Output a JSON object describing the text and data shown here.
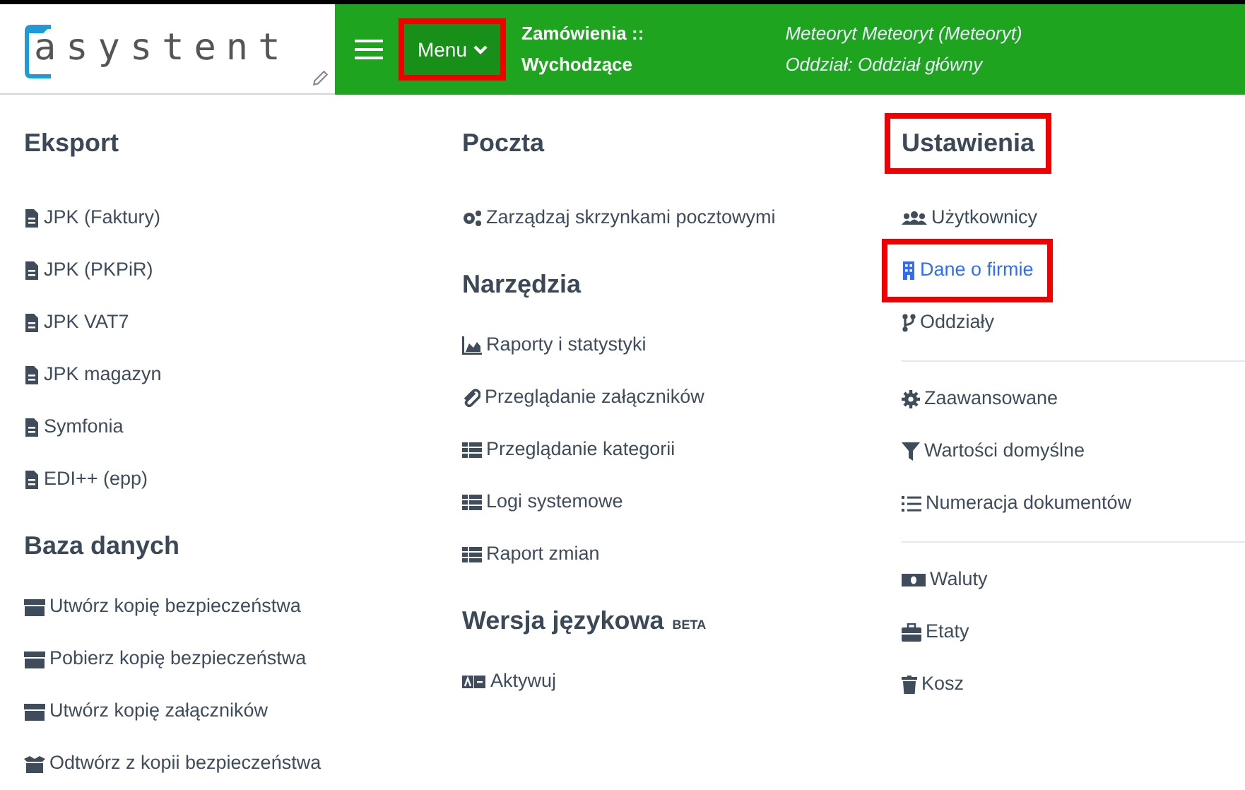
{
  "header": {
    "logo": "asystent",
    "menu_button": {
      "label": "Menu",
      "highlighted": true
    },
    "breadcrumb": [
      "Zamówienia ::",
      "Wychodzące"
    ],
    "user": "Meteoryt Meteoryt (Meteoryt)",
    "branch": "Oddział: Oddział główny"
  },
  "columns": [
    [
      {
        "kind": "heading",
        "label": "Eksport",
        "highlighted": false
      },
      {
        "kind": "item",
        "label": "JPK (Faktury)",
        "active": false,
        "highlighted": false
      },
      {
        "kind": "item",
        "label": "JPK (PKPiR)",
        "active": false,
        "highlighted": false
      },
      {
        "kind": "item",
        "label": "JPK VAT7",
        "active": false,
        "highlighted": false
      },
      {
        "kind": "item",
        "label": "JPK magazyn",
        "active": false,
        "highlighted": false
      },
      {
        "kind": "item",
        "label": "Symfonia",
        "active": false,
        "highlighted": false
      },
      {
        "kind": "item",
        "label": "EDI++ (epp)",
        "active": false,
        "highlighted": false
      },
      {
        "kind": "heading",
        "label": "Baza danych",
        "highlighted": false
      },
      {
        "kind": "item",
        "label": "Utwórz kopię bezpieczeństwa",
        "active": false,
        "highlighted": false
      },
      {
        "kind": "item",
        "label": "Pobierz kopię bezpieczeństwa",
        "active": false,
        "highlighted": false
      },
      {
        "kind": "item",
        "label": "Utwórz kopię załączników",
        "active": false,
        "highlighted": false
      },
      {
        "kind": "item",
        "label": "Odtwórz z kopii bezpieczeństwa",
        "active": false,
        "highlighted": false
      }
    ],
    [
      {
        "kind": "heading",
        "label": "Poczta",
        "highlighted": false
      },
      {
        "kind": "item",
        "label": "Zarządzaj skrzynkami pocztowymi",
        "active": false,
        "highlighted": false
      },
      {
        "kind": "heading",
        "label": "Narzędzia",
        "highlighted": false
      },
      {
        "kind": "item",
        "label": "Raporty i statystyki",
        "active": false,
        "highlighted": false
      },
      {
        "kind": "item",
        "label": "Przeglądanie załączników",
        "active": false,
        "highlighted": false
      },
      {
        "kind": "item",
        "label": "Przeglądanie kategorii",
        "active": false,
        "highlighted": false
      },
      {
        "kind": "item",
        "label": "Logi systemowe",
        "active": false,
        "highlighted": false
      },
      {
        "kind": "item",
        "label": "Raport zmian",
        "active": false,
        "highlighted": false
      },
      {
        "kind": "heading",
        "label": "Wersja językowa",
        "badge": "BETA",
        "highlighted": false
      },
      {
        "kind": "item",
        "label": "Aktywuj",
        "active": false,
        "highlighted": false
      }
    ],
    [
      {
        "kind": "heading",
        "label": "Ustawienia",
        "highlighted": true
      },
      {
        "kind": "item",
        "label": "Użytkownicy",
        "active": false,
        "highlighted": false
      },
      {
        "kind": "item",
        "label": "Dane o firmie",
        "active": true,
        "highlighted": true
      },
      {
        "kind": "item",
        "label": "Oddziały",
        "active": false,
        "highlighted": false
      },
      {
        "kind": "divider"
      },
      {
        "kind": "item",
        "label": "Zaawansowane",
        "active": false,
        "highlighted": false
      },
      {
        "kind": "item",
        "label": "Wartości domyślne",
        "active": false,
        "highlighted": false
      },
      {
        "kind": "item",
        "label": "Numeracja dokumentów",
        "active": false,
        "highlighted": false
      },
      {
        "kind": "divider"
      },
      {
        "kind": "item",
        "label": "Waluty",
        "active": false,
        "highlighted": false
      },
      {
        "kind": "item",
        "label": "Etaty",
        "active": false,
        "highlighted": false
      },
      {
        "kind": "item",
        "label": "Kosz",
        "active": false,
        "highlighted": false
      }
    ]
  ]
}
